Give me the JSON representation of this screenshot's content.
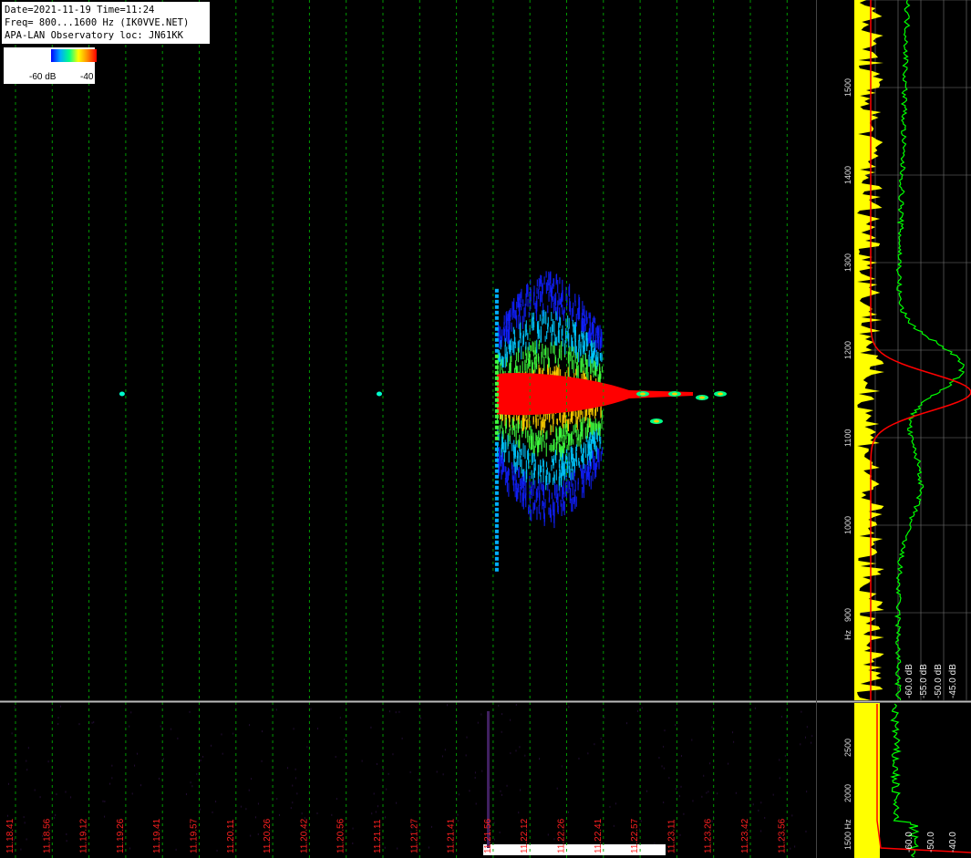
{
  "header": {
    "line1": "Date=2021-11-19 Time=11:24",
    "line2": "Freq= 800...1600 Hz (IK0VVE.NET)",
    "line3": "APA-LAN Observatory loc: JN61KK"
  },
  "color_scale": {
    "low_label": "-60 dB",
    "high_label": "-40"
  },
  "colors": {
    "strong": "#ff0000",
    "mid": "#00ff00",
    "weak": "#0000ff",
    "grid": "#00aa00",
    "time_label": "#ff2020",
    "spectrum_yellow": "#ffff00",
    "spectrum_green": "#00ff00",
    "spectrum_red": "#ff0000"
  },
  "chart_data": [
    {
      "type": "heatmap",
      "title": "",
      "ylabel": "Hz",
      "y_ticks": [
        "900",
        "1000",
        "1100",
        "1200",
        "1300",
        "1400",
        "1500"
      ],
      "ylim": [
        800,
        1600
      ],
      "x_ticks": [
        "11.18.41",
        "11.18.56",
        "11.19.12",
        "11.19.26",
        "11.19.41",
        "11.19.57",
        "11.20.11",
        "11.20.26",
        "11.20.42",
        "11.20.56",
        "11.21.11",
        "11.21.27",
        "11.21.41",
        "11.21.56",
        "11.22.12",
        "11.22.26",
        "11.22.41",
        "11.22.57",
        "11.23.11",
        "11.23.26",
        "11.23.42",
        "11.23.56"
      ],
      "features": [
        {
          "name": "meteor-echo",
          "time_start": "11.21.56",
          "time_end": "11.23.11",
          "freq_center": 1150,
          "freq_range": [
            950,
            1270
          ]
        },
        {
          "name": "carrier-dot-1",
          "time": "11.19.26",
          "freq": 1150
        },
        {
          "name": "carrier-dot-2",
          "time": "11.21.11",
          "freq": 1150
        }
      ]
    },
    {
      "type": "line",
      "title": "",
      "xlabel": "dB",
      "x_ticks": [
        "-60.0 dB",
        "-55.0 dB",
        "-50.0 dB",
        "-45.0 dB"
      ],
      "xlim": [
        -62.5,
        -42.5
      ],
      "ylim": [
        800,
        1600
      ],
      "series_colors": [
        "yellow",
        "green",
        "red"
      ]
    },
    {
      "type": "heatmap",
      "title": "",
      "ylabel": "Hz",
      "y_ticks": [
        "1500 Hz",
        "2000",
        "2500"
      ],
      "x_ticks_note": "shares time axis with main spectrogram"
    },
    {
      "type": "line",
      "x_ticks": [
        "-60.0",
        "-50.0",
        "-40.0"
      ],
      "series_colors": [
        "yellow",
        "green",
        "red"
      ]
    }
  ]
}
